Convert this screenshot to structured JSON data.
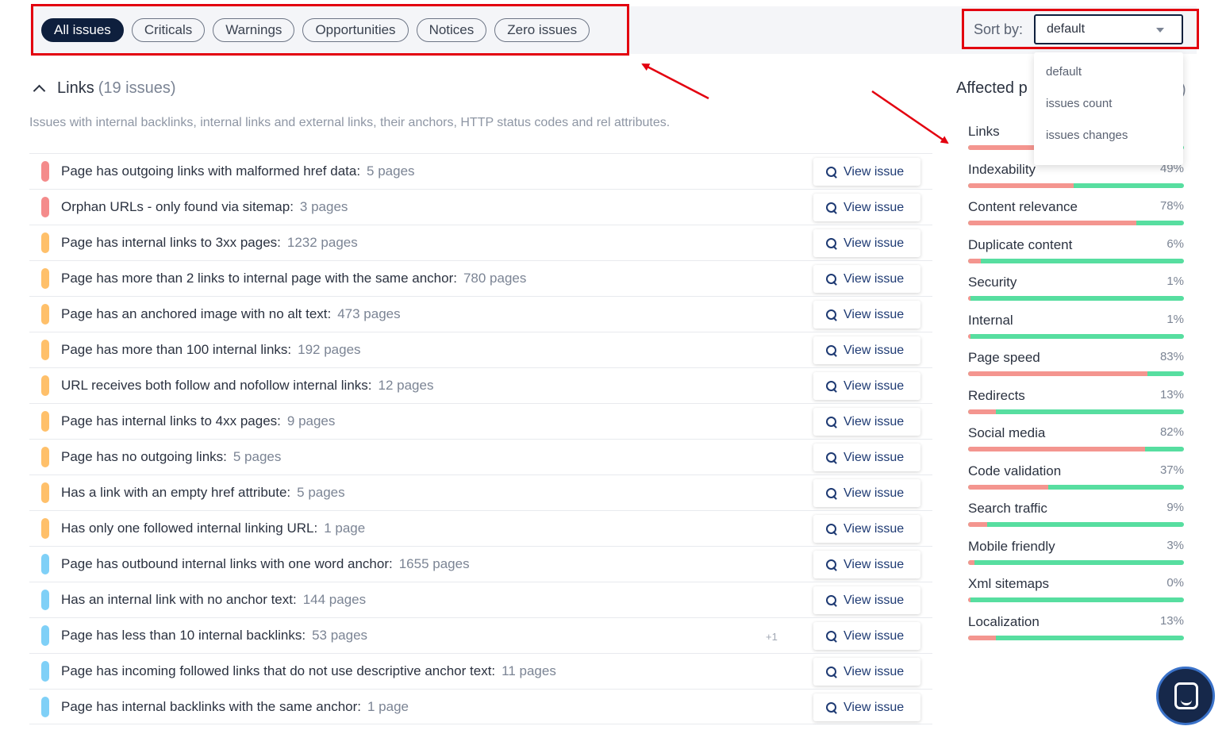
{
  "filters": [
    {
      "label": "All issues",
      "active": true
    },
    {
      "label": "Criticals",
      "active": false
    },
    {
      "label": "Warnings",
      "active": false
    },
    {
      "label": "Opportunities",
      "active": false
    },
    {
      "label": "Notices",
      "active": false
    },
    {
      "label": "Zero issues",
      "active": false
    }
  ],
  "sort": {
    "label": "Sort by:",
    "selected": "default",
    "options": [
      "default",
      "issues count",
      "issues changes"
    ]
  },
  "section": {
    "title": "Links",
    "count": "(19 issues)",
    "description": "Issues with internal backlinks, internal links and external links, their anchors, HTTP status codes and rel attributes."
  },
  "issues": [
    {
      "severity": "critical",
      "text": "Page has outgoing links with malformed href data:",
      "pages": "5 pages",
      "extra": ""
    },
    {
      "severity": "critical",
      "text": "Orphan URLs - only found via sitemap:",
      "pages": "3 pages",
      "extra": ""
    },
    {
      "severity": "warning",
      "text": "Page has internal links to 3xx pages:",
      "pages": "1232 pages",
      "extra": ""
    },
    {
      "severity": "warning",
      "text": "Page has more than 2 links to internal page with the same anchor:",
      "pages": "780 pages",
      "extra": ""
    },
    {
      "severity": "warning",
      "text": "Page has an anchored image with no alt text:",
      "pages": "473 pages",
      "extra": ""
    },
    {
      "severity": "warning",
      "text": "Page has more than 100 internal links:",
      "pages": "192 pages",
      "extra": ""
    },
    {
      "severity": "warning",
      "text": "URL receives both follow and nofollow internal links:",
      "pages": "12 pages",
      "extra": ""
    },
    {
      "severity": "warning",
      "text": "Page has internal links to 4xx pages:",
      "pages": "9 pages",
      "extra": ""
    },
    {
      "severity": "warning",
      "text": "Page has no outgoing links:",
      "pages": "5 pages",
      "extra": ""
    },
    {
      "severity": "warning",
      "text": "Has a link with an empty href attribute:",
      "pages": "5 pages",
      "extra": ""
    },
    {
      "severity": "warning",
      "text": "Has only one followed internal linking URL:",
      "pages": "1 page",
      "extra": ""
    },
    {
      "severity": "notice",
      "text": "Page has outbound internal links with one word anchor:",
      "pages": "1655 pages",
      "extra": ""
    },
    {
      "severity": "notice",
      "text": "Has an internal link with no anchor text:",
      "pages": "144 pages",
      "extra": ""
    },
    {
      "severity": "notice",
      "text": "Page has less than 10 internal backlinks:",
      "pages": "53 pages",
      "extra": "+1"
    },
    {
      "severity": "notice",
      "text": "Page has incoming followed links that do not use descriptive anchor text:",
      "pages": "11 pages",
      "extra": ""
    },
    {
      "severity": "notice",
      "text": "Page has internal backlinks with the same anchor:",
      "pages": "1 page",
      "extra": ""
    }
  ],
  "view_issue_label": "View issue",
  "affected": {
    "title": "Affected p",
    "title_tail": ")",
    "categories": [
      {
        "name": "Links",
        "pct": "",
        "value": 31
      },
      {
        "name": "Indexability",
        "pct": "49%",
        "value": 49
      },
      {
        "name": "Content relevance",
        "pct": "78%",
        "value": 78
      },
      {
        "name": "Duplicate content",
        "pct": "6%",
        "value": 6
      },
      {
        "name": "Security",
        "pct": "1%",
        "value": 1
      },
      {
        "name": "Internal",
        "pct": "1%",
        "value": 1
      },
      {
        "name": "Page speed",
        "pct": "83%",
        "value": 83
      },
      {
        "name": "Redirects",
        "pct": "13%",
        "value": 13
      },
      {
        "name": "Social media",
        "pct": "82%",
        "value": 82
      },
      {
        "name": "Code validation",
        "pct": "37%",
        "value": 37
      },
      {
        "name": "Search traffic",
        "pct": "9%",
        "value": 9
      },
      {
        "name": "Mobile friendly",
        "pct": "3%",
        "value": 3
      },
      {
        "name": "Xml sitemaps",
        "pct": "0%",
        "value": 0
      },
      {
        "name": "Localization",
        "pct": "13%",
        "value": 13
      }
    ]
  },
  "colors": {
    "critical": "#f48b8b",
    "warning": "#ffc06a",
    "notice": "#7fd0f7",
    "bar_ok": "#57dea0",
    "bar_bad": "#f4958f",
    "annotation": "#e3000f",
    "accent": "#0e1f3d"
  },
  "icons": {
    "view_issue": "search-icon",
    "section_toggle": "chevron-up-icon",
    "sort_caret": "caret-down-icon",
    "chat": "chat-icon"
  }
}
